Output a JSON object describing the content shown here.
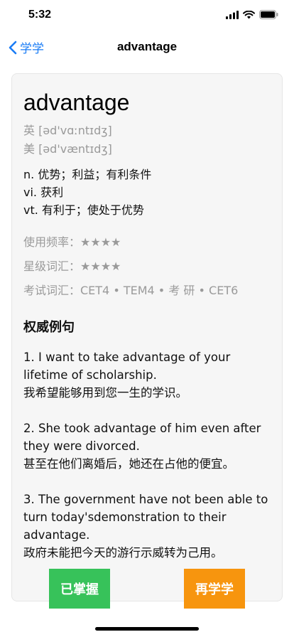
{
  "status_bar": {
    "time": "5:32",
    "icons": [
      "signal-icon",
      "wifi-icon",
      "battery-icon"
    ]
  },
  "nav": {
    "back_label": "学学",
    "title": "advantage"
  },
  "word": {
    "headword": "advantage",
    "phonetics": [
      "英 [əd'vɑːntɪdʒ]",
      "美 [əd'væntɪdʒ]"
    ],
    "definitions": [
      "n. 优势；利益；有利条件",
      "vi. 获利",
      "vt. 有利于；使处于优势"
    ],
    "meta": {
      "frequency": "使用频率：★★★★",
      "level": "星级词汇：★★★★",
      "exams": "考试词汇：CET4 • TEM4 • 考 研 • CET6"
    }
  },
  "examples_section": {
    "title": "权威例句",
    "items": [
      {
        "en_lines": [
          "1. I want to take advantage of your",
          "lifetime of scholarship."
        ],
        "zh": "我希望能够用到您一生的学识。"
      },
      {
        "en_lines": [
          "2. She took advantage of him even after",
          "they were divorced."
        ],
        "zh": "甚至在他们离婚后，她还在占他的便宜。"
      },
      {
        "en_lines": [
          "3. The government have not been able to",
          "turn today'sdemonstration to their",
          "advantage."
        ],
        "zh": "政府未能把今天的游行示威转为己用。"
      }
    ]
  },
  "buttons": {
    "mastered": "已掌握",
    "learn_again": "再学学"
  },
  "colors": {
    "accent_blue": "#1a7cf5",
    "mastered_green": "#37c25a",
    "again_orange": "#f7950e"
  }
}
